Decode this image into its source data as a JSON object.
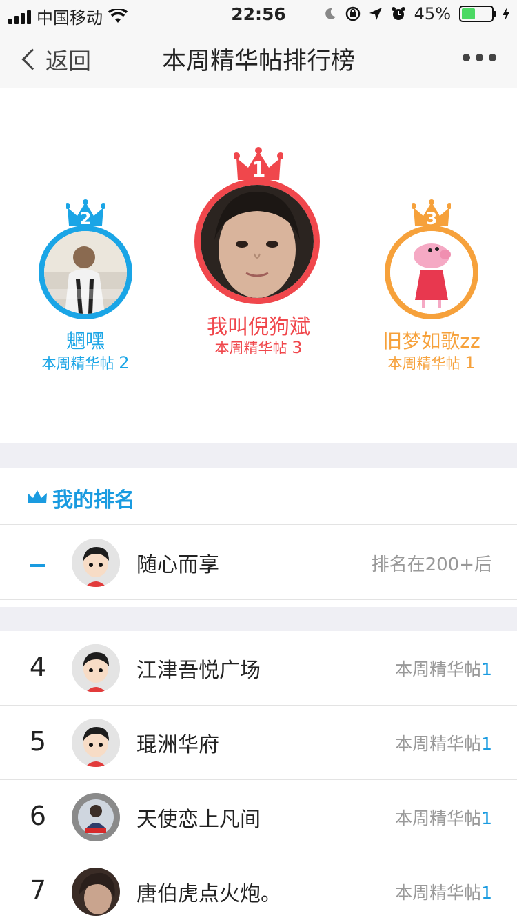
{
  "status_bar": {
    "carrier": "中国移动",
    "time": "22:56",
    "battery_percent": "45%",
    "battery_level": 0.45
  },
  "nav": {
    "back_label": "返回",
    "title": "本周精华帖排行榜"
  },
  "podium": [
    {
      "rank": "1",
      "name": "我叫倪狗斌",
      "count_label": "本周精华帖",
      "count": "3",
      "color": "#f0474c"
    },
    {
      "rank": "2",
      "name": "魍嘿",
      "count_label": "本周精华帖",
      "count": "2",
      "color": "#1aa5e6"
    },
    {
      "rank": "3",
      "name": "旧梦如歌zz",
      "count_label": "本周精华帖",
      "count": "1",
      "color": "#f6a13b"
    }
  ],
  "my_rank": {
    "header": "我的排名",
    "name": "随心而享",
    "rank_text": "排名在200+后"
  },
  "list": [
    {
      "rank": "4",
      "name": "江津吾悦广场",
      "label": "本周精华帖",
      "count": "1"
    },
    {
      "rank": "5",
      "name": "琨洲华府",
      "label": "本周精华帖",
      "count": "1"
    },
    {
      "rank": "6",
      "name": "天使恋上凡间",
      "label": "本周精华帖",
      "count": "1"
    },
    {
      "rank": "7",
      "name": "唐伯虎点火炮。",
      "label": "本周精华帖",
      "count": "1"
    }
  ],
  "colors": {
    "accent": "#1a9be0",
    "gold": "#f0474c",
    "silver": "#1aa5e6",
    "bronze": "#f6a13b"
  }
}
